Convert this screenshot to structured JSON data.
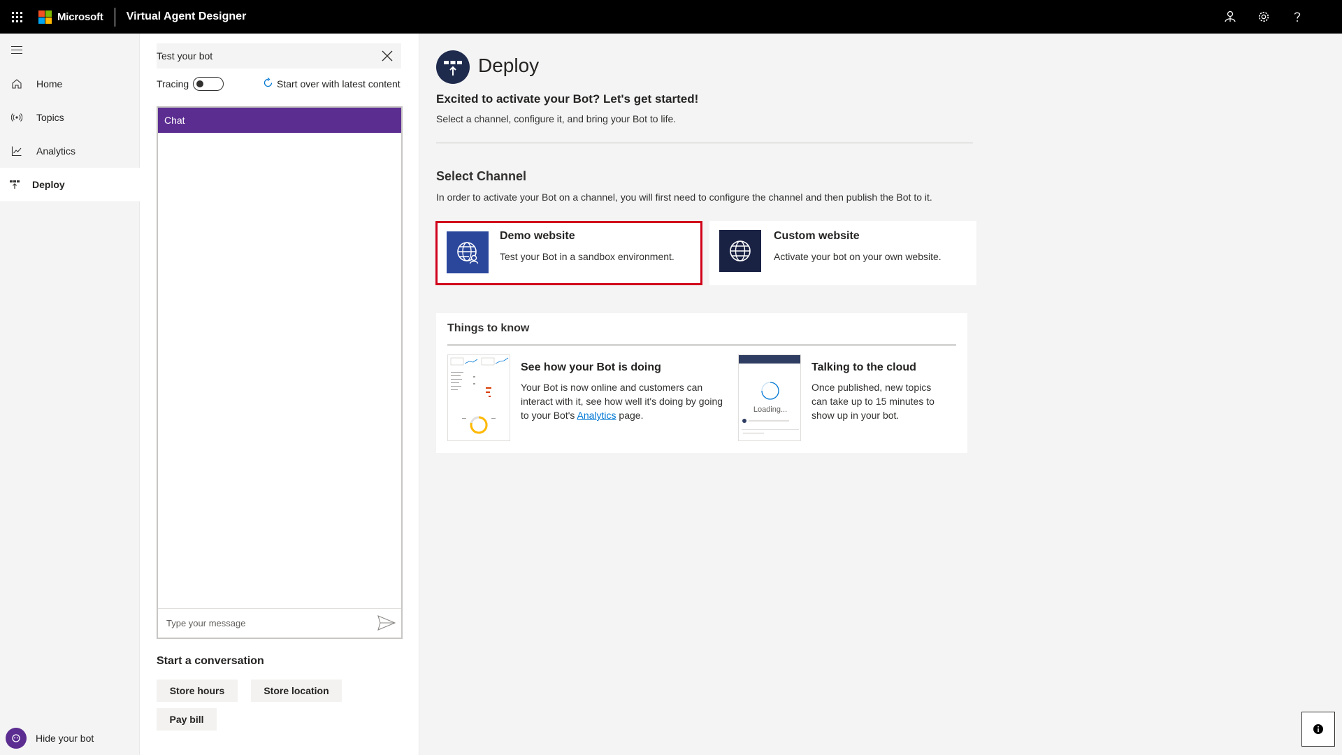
{
  "topbar": {
    "brand": "Microsoft",
    "app_title": "Virtual Agent Designer",
    "icons": [
      "waffle-icon",
      "person-icon",
      "gear-icon",
      "help-icon"
    ]
  },
  "nav": {
    "items": [
      {
        "label": "Home",
        "icon": "home-icon"
      },
      {
        "label": "Topics",
        "icon": "topics-icon"
      },
      {
        "label": "Analytics",
        "icon": "analytics-icon"
      },
      {
        "label": "Deploy",
        "icon": "deploy-icon",
        "active": true
      }
    ],
    "hide_bot": "Hide your bot"
  },
  "test_panel": {
    "title": "Test your bot",
    "tracing_label": "Tracing",
    "start_over": "Start over with latest content",
    "chat_title": "Chat",
    "input_placeholder": "Type your message",
    "start_conversation": "Start a conversation",
    "suggestions": [
      "Store hours",
      "Store location",
      "Pay bill"
    ]
  },
  "main": {
    "title": "Deploy",
    "subtitle": "Excited to activate your Bot? Let's get started!",
    "description": "Select a channel, configure it, and bring your Bot to life.",
    "select_channel": {
      "title": "Select Channel",
      "description": "In order to activate your Bot on a channel, you will first need to configure the channel and then publish the Bot to it."
    },
    "channels": [
      {
        "title": "Demo website",
        "description": "Test your Bot in a sandbox environment.",
        "icon": "globe-person-icon",
        "color": "#2b479c",
        "selected": true
      },
      {
        "title": "Custom website",
        "description": "Activate your bot on your own website.",
        "icon": "globe-icon",
        "color": "#1a2244",
        "selected": false
      }
    ],
    "things_to_know": {
      "title": "Things to know",
      "items": [
        {
          "title": "See how your Bot is doing",
          "text_before": "Your Bot is now online and customers can interact with it, see how well it's doing by going to your Bot's ",
          "link": "Analytics",
          "text_after": " page."
        },
        {
          "title": "Talking to the cloud",
          "text": "Once published, new topics can take up to 15 minutes to show up in your bot.",
          "thumb_text": "Loading..."
        }
      ]
    }
  },
  "colors": {
    "accent_purple": "#5c2d91",
    "selected_border": "#d0021b",
    "link": "#0078d4"
  }
}
